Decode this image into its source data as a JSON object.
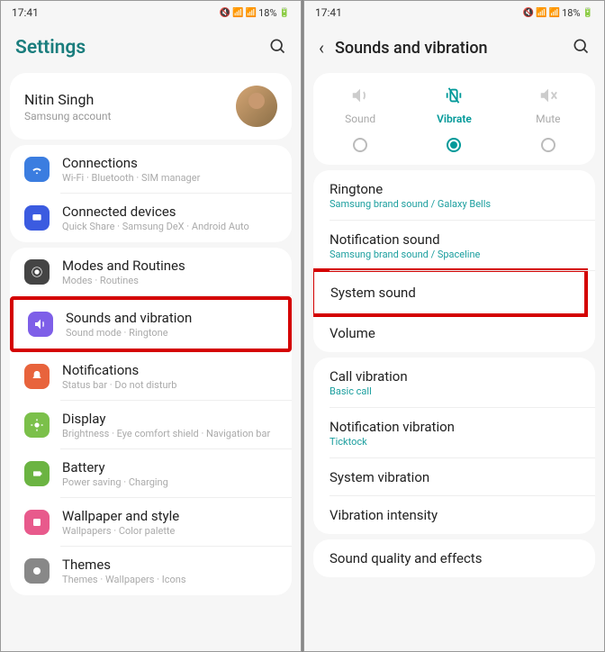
{
  "statusbar": {
    "time": "17:41",
    "battery": "18%"
  },
  "left": {
    "title": "Settings",
    "profile": {
      "name": "Nitin Singh",
      "sub": "Samsung account"
    },
    "group1": [
      {
        "title": "Connections",
        "sub": "Wi-Fi · Bluetooth · SIM manager",
        "color": "#3b7de0"
      },
      {
        "title": "Connected devices",
        "sub": "Quick Share · Samsung DeX · Android Auto",
        "color": "#3b5be0"
      }
    ],
    "group2": [
      {
        "title": "Modes and Routines",
        "sub": "Modes · Routines",
        "color": "#444"
      },
      {
        "title": "Sounds and vibration",
        "sub": "Sound mode · Ringtone",
        "color": "#7e5fe8"
      },
      {
        "title": "Notifications",
        "sub": "Status bar · Do not disturb",
        "color": "#e8633c"
      },
      {
        "title": "Display",
        "sub": "Brightness · Eye comfort shield · Navigation bar",
        "color": "#7bc04a"
      },
      {
        "title": "Battery",
        "sub": "Power saving · Charging",
        "color": "#6bb442"
      },
      {
        "title": "Wallpaper and style",
        "sub": "Wallpapers · Color palette",
        "color": "#e85a8c"
      },
      {
        "title": "Themes",
        "sub": "Themes · Wallpapers · Icons",
        "color": "#888"
      }
    ]
  },
  "right": {
    "title": "Sounds and vibration",
    "modes": [
      {
        "label": "Sound",
        "active": false
      },
      {
        "label": "Vibrate",
        "active": true
      },
      {
        "label": "Mute",
        "active": false
      }
    ],
    "group1": [
      {
        "title": "Ringtone",
        "sub": "Samsung brand sound / Galaxy Bells"
      },
      {
        "title": "Notification sound",
        "sub": "Samsung brand sound / Spaceline"
      },
      {
        "title": "System sound",
        "sub": ""
      },
      {
        "title": "Volume",
        "sub": ""
      }
    ],
    "group2": [
      {
        "title": "Call vibration",
        "sub": "Basic call"
      },
      {
        "title": "Notification vibration",
        "sub": "Ticktock"
      },
      {
        "title": "System vibration",
        "sub": ""
      },
      {
        "title": "Vibration intensity",
        "sub": ""
      }
    ],
    "group3": [
      {
        "title": "Sound quality and effects",
        "sub": ""
      }
    ]
  }
}
